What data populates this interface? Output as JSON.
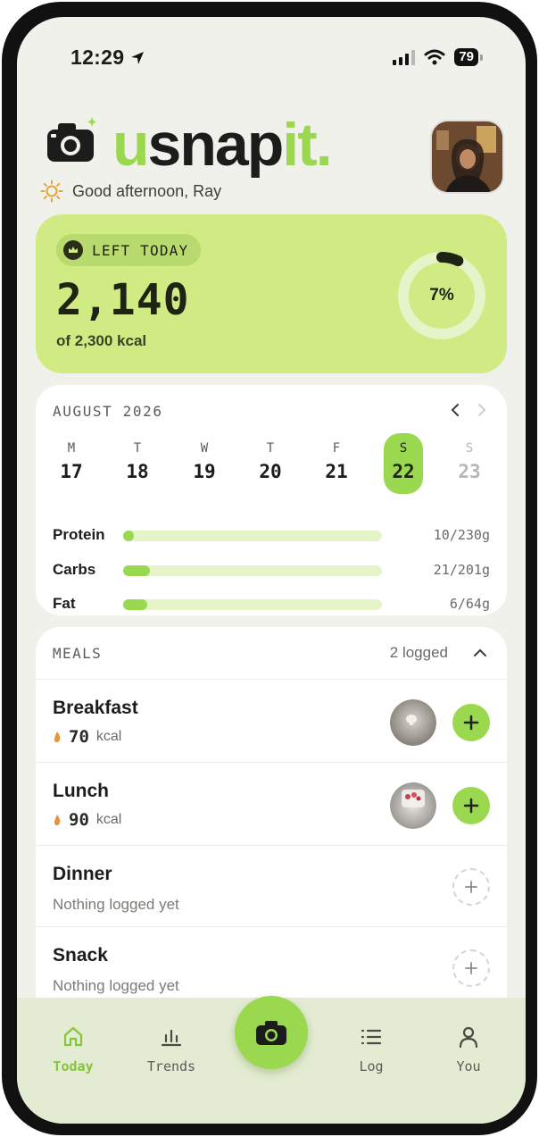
{
  "status_bar": {
    "time": "12:29",
    "battery": "79"
  },
  "header": {
    "brand_green_1": "u",
    "brand_dark": "snap",
    "brand_green_2": "it.",
    "greeting": "Good afternoon, Ray"
  },
  "calories": {
    "pill_label": "LEFT TODAY",
    "remaining": "2,140",
    "of_total": "of 2,300 kcal",
    "percent_label": "7%",
    "percent_value": 0.07
  },
  "calendar": {
    "month": "AUGUST 2026",
    "days": [
      {
        "letter": "M",
        "num": "17"
      },
      {
        "letter": "T",
        "num": "18"
      },
      {
        "letter": "W",
        "num": "19"
      },
      {
        "letter": "T",
        "num": "20"
      },
      {
        "letter": "F",
        "num": "21"
      },
      {
        "letter": "S",
        "num": "22"
      },
      {
        "letter": "S",
        "num": "23"
      }
    ]
  },
  "macros": [
    {
      "name": "Protein",
      "value": "10/230g",
      "fraction": 0.043
    },
    {
      "name": "Carbs",
      "value": "21/201g",
      "fraction": 0.104
    },
    {
      "name": "Fat",
      "value": "6/64g",
      "fraction": 0.094
    }
  ],
  "meals": {
    "title": "MEALS",
    "count": "2 logged",
    "items": [
      {
        "name": "Breakfast",
        "kcal": "70",
        "unit": "kcal"
      },
      {
        "name": "Lunch",
        "kcal": "90",
        "unit": "kcal"
      },
      {
        "name": "Dinner",
        "empty": "Nothing logged yet"
      },
      {
        "name": "Snack",
        "empty": "Nothing logged yet"
      }
    ]
  },
  "tabs": [
    {
      "label": "Today",
      "icon": "home-icon"
    },
    {
      "label": "Trends",
      "icon": "bar-chart-icon"
    },
    {
      "label": "Log",
      "icon": "list-icon"
    },
    {
      "label": "You",
      "icon": "user-icon"
    }
  ],
  "colors": {
    "accent": "#9ad84f",
    "card_green": "#d0eb83",
    "background": "#f1f1ec"
  }
}
